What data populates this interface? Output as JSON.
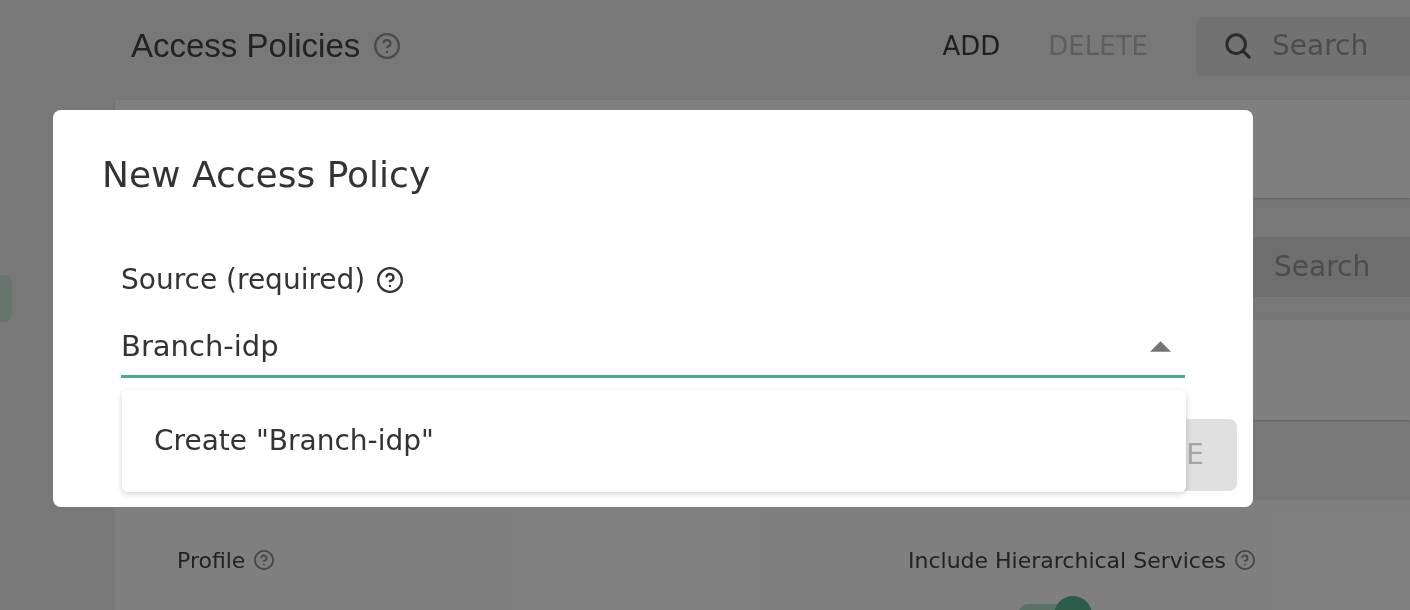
{
  "page": {
    "title": "Access Policies",
    "actions": [
      {
        "label": "ADD",
        "disabled": false
      },
      {
        "label": "DELETE",
        "disabled": true
      }
    ],
    "search": {
      "placeholder": "Search"
    }
  },
  "list_search": {
    "placeholder": "Search"
  },
  "settings": {
    "fields": [
      {
        "kind": "text",
        "label": "Profile"
      },
      {
        "kind": "toggle",
        "label": "Include Hierarchical Services",
        "on": true
      }
    ]
  },
  "dialog": {
    "title": "New Access Policy",
    "field": {
      "label": "Source (required)",
      "value": "Branch-idp",
      "expanded": true,
      "options": [
        {
          "label": "Create \"Branch-idp\"",
          "selected": false
        }
      ]
    },
    "buttons": [
      {
        "label": "E",
        "disabled": true
      }
    ]
  }
}
